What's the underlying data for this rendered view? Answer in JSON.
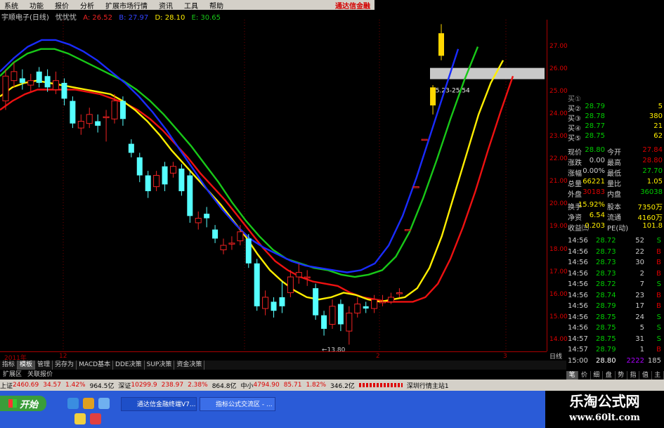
{
  "menu": {
    "items": [
      "系统",
      "功能",
      "报价",
      "分析",
      "扩展市场行情",
      "资讯",
      "工具",
      "帮助"
    ],
    "brand": "通达信金融"
  },
  "title": {
    "stock": "宇顺电子(日线)",
    "indicator": "忧忧忧",
    "a": "A: 26.52",
    "b": "B: 27.97",
    "d": "D: 28.10",
    "e": "E: 30.65"
  },
  "chart": {
    "y_ticks": [
      "27.00",
      "26.00",
      "25.00",
      "24.00",
      "23.00",
      "22.00",
      "21.00",
      "20.00",
      "19.00",
      "18.00",
      "17.00",
      "16.00",
      "15.00",
      "14.00"
    ],
    "x_labels": [
      "2011年",
      "12",
      "2",
      "3"
    ],
    "low_label": "←13.80",
    "range_label": "25.23-25.54",
    "colors": {
      "blue": "#1a2cff",
      "green": "#18c818",
      "red": "#ee1111",
      "yellow": "#ffee00",
      "up": "#ee2222",
      "down": "#55ffff"
    }
  },
  "chart_data": {
    "type": "candlestick",
    "y_range": [
      13.5,
      28.2
    ],
    "candles": [
      {
        "o": 24.6,
        "c": 25.7,
        "h": 26.0,
        "l": 24.2
      },
      {
        "o": 25.5,
        "c": 25.9,
        "h": 26.3,
        "l": 25.2
      },
      {
        "o": 25.6,
        "c": 25.4,
        "h": 26.0,
        "l": 25.1
      },
      {
        "o": 25.3,
        "c": 25.5,
        "h": 25.8,
        "l": 25.0
      },
      {
        "o": 25.9,
        "c": 25.4,
        "h": 26.1,
        "l": 25.2
      },
      {
        "o": 25.7,
        "c": 25.2,
        "h": 26.0,
        "l": 25.0
      },
      {
        "o": 25.1,
        "c": 25.5,
        "h": 25.9,
        "l": 24.9
      },
      {
        "o": 25.4,
        "c": 24.7,
        "h": 25.6,
        "l": 24.4
      },
      {
        "o": 24.6,
        "c": 23.6,
        "h": 24.8,
        "l": 23.4
      },
      {
        "o": 23.4,
        "c": 23.7,
        "h": 24.0,
        "l": 23.1
      },
      {
        "o": 23.6,
        "c": 24.0,
        "h": 24.3,
        "l": 23.4
      },
      {
        "o": 23.7,
        "c": 23.5,
        "h": 24.0,
        "l": 23.2
      },
      {
        "o": 23.9,
        "c": 23.9,
        "h": 24.2,
        "l": 22.8
      },
      {
        "o": 23.8,
        "c": 24.6,
        "h": 24.9,
        "l": 23.6
      },
      {
        "o": 24.6,
        "c": 23.8,
        "h": 24.8,
        "l": 23.5
      },
      {
        "o": 22.7,
        "c": 22.3,
        "h": 22.9,
        "l": 22.1
      },
      {
        "o": 22.1,
        "c": 21.3,
        "h": 22.3,
        "l": 21.0
      },
      {
        "o": 21.3,
        "c": 20.6,
        "h": 21.5,
        "l": 20.3
      },
      {
        "o": 20.8,
        "c": 21.3,
        "h": 21.5,
        "l": 20.6
      },
      {
        "o": 21.7,
        "c": 20.9,
        "h": 21.9,
        "l": 20.6
      },
      {
        "o": 21.4,
        "c": 21.7,
        "h": 21.9,
        "l": 21.2
      },
      {
        "o": 21.6,
        "c": 20.6,
        "h": 21.8,
        "l": 20.4
      },
      {
        "o": 21.3,
        "c": 19.5,
        "h": 21.5,
        "l": 19.2
      },
      {
        "o": 19.2,
        "c": 19.4,
        "h": 19.7,
        "l": 18.9
      },
      {
        "o": 19.6,
        "c": 19.4,
        "h": 19.9,
        "l": 19.0
      },
      {
        "o": 18.9,
        "c": 18.5,
        "h": 19.1,
        "l": 18.3
      },
      {
        "o": 18.0,
        "c": 18.2,
        "h": 18.5,
        "l": 17.8
      },
      {
        "o": 18.3,
        "c": 18.3,
        "h": 18.6,
        "l": 18.0
      },
      {
        "o": 18.4,
        "c": 18.8,
        "h": 19.1,
        "l": 18.2
      },
      {
        "o": 18.5,
        "c": 17.4,
        "h": 18.7,
        "l": 17.2
      },
      {
        "o": 17.4,
        "c": 15.5,
        "h": 17.6,
        "l": 15.3
      },
      {
        "o": 15.4,
        "c": 15.9,
        "h": 16.2,
        "l": 15.1
      },
      {
        "o": 15.7,
        "c": 15.3,
        "h": 15.9,
        "l": 15.0
      },
      {
        "o": 15.9,
        "c": 15.5,
        "h": 16.6,
        "l": 15.2
      },
      {
        "o": 16.1,
        "c": 16.8,
        "h": 17.1,
        "l": 15.9
      },
      {
        "o": 16.8,
        "c": 17.0,
        "h": 17.4,
        "l": 16.5
      },
      {
        "o": 16.8,
        "c": 16.8,
        "h": 17.1,
        "l": 16.4
      },
      {
        "o": 16.3,
        "c": 15.1,
        "h": 16.5,
        "l": 14.9
      },
      {
        "o": 15.1,
        "c": 14.5,
        "h": 15.3,
        "l": 14.2
      },
      {
        "o": 14.7,
        "c": 15.5,
        "h": 15.8,
        "l": 14.5
      },
      {
        "o": 15.6,
        "c": 14.7,
        "h": 15.8,
        "l": 14.4
      },
      {
        "o": 14.4,
        "c": 15.2,
        "h": 15.5,
        "l": 13.8
      },
      {
        "o": 15.2,
        "c": 15.6,
        "h": 15.9,
        "l": 15.0
      },
      {
        "o": 15.5,
        "c": 15.4,
        "h": 15.7,
        "l": 15.2
      },
      {
        "o": 15.4,
        "c": 15.8,
        "h": 16.0,
        "l": 15.2
      },
      {
        "o": 15.7,
        "c": 15.7,
        "h": 16.0,
        "l": 15.5
      },
      {
        "o": 15.7,
        "c": 15.9,
        "h": 16.1,
        "l": 15.6
      },
      {
        "o": 16.1,
        "c": 16.1,
        "h": 16.3,
        "l": 15.9
      },
      {
        "o": 18.9,
        "c": 18.9,
        "h": 18.9,
        "l": 18.9
      },
      {
        "o": 20.8,
        "c": 20.8,
        "h": 20.8,
        "l": 20.8
      },
      {
        "o": 22.9,
        "c": 22.9,
        "h": 22.9,
        "l": 22.9
      },
      {
        "o": 24.4,
        "c": 25.2,
        "h": 25.3,
        "l": 24.0
      },
      {
        "o": 26.6,
        "c": 27.6,
        "h": 28.0,
        "l": 26.4
      }
    ],
    "lines": {
      "yellow": [
        24.8,
        25.2,
        25.4,
        25.5,
        25.4,
        25.3,
        25.2,
        25.1,
        25.0,
        24.9,
        24.6,
        24.2,
        23.7,
        23.1,
        22.4,
        21.8,
        21.2,
        20.6,
        20.0,
        19.3,
        18.6,
        17.8,
        17.1,
        16.6,
        16.2,
        15.9,
        15.8,
        15.9,
        16.1,
        16.0,
        15.8,
        15.7,
        15.8,
        15.9,
        16.3,
        17.2,
        18.6,
        20.4,
        22.2,
        24.0,
        25.4,
        26.4
      ],
      "red": [
        24.2,
        24.6,
        24.9,
        25.1,
        25.1,
        25.1,
        25.1,
        25.0,
        24.9,
        24.7,
        24.5,
        24.2,
        23.8,
        23.3,
        22.7,
        22.1,
        21.4,
        20.8,
        20.2,
        19.5,
        18.8,
        18.1,
        17.5,
        17.1,
        16.8,
        16.6,
        16.5,
        16.4,
        16.1,
        15.9,
        15.8,
        15.7,
        15.7,
        15.7,
        15.9,
        16.5,
        17.6,
        19.0,
        20.6,
        22.4,
        24.1,
        25.7
      ],
      "green": [
        25.7,
        26.3,
        26.7,
        26.9,
        26.9,
        26.7,
        26.4,
        26.1,
        25.8,
        25.5,
        25.1,
        24.6,
        24.0,
        23.3,
        22.6,
        21.8,
        21.0,
        20.1,
        19.3,
        18.6,
        18.0,
        17.6,
        17.4,
        17.2,
        17.1,
        16.9,
        16.8,
        16.9,
        17.1,
        17.7,
        18.8,
        20.3,
        22.0,
        23.8,
        25.5,
        27.0
      ],
      "blue": [
        25.9,
        26.5,
        27.0,
        27.3,
        27.3,
        27.1,
        26.8,
        26.4,
        25.9,
        25.4,
        24.8,
        24.1,
        23.3,
        22.4,
        21.5,
        20.6,
        19.8,
        19.1,
        18.5,
        18.1,
        17.8,
        17.5,
        17.3,
        17.2,
        17.1,
        17.0,
        17.1,
        17.4,
        18.2,
        19.5,
        21.2,
        23.1,
        25.0,
        26.9
      ]
    }
  },
  "tabs": [
    "指标",
    "模板",
    "管理",
    "另存为",
    "MACD基本",
    "DDE决策",
    "SUP决策",
    "资金决策"
  ],
  "tabs2": [
    "扩展区",
    "关联报价"
  ],
  "quote": {
    "asks": [
      {
        "label": "买②",
        "price": "28.79",
        "vol": "5"
      },
      {
        "label": "买③",
        "price": "28.78",
        "vol": "380"
      },
      {
        "label": "买④",
        "price": "28.77",
        "vol": "21"
      },
      {
        "label": "买⑤",
        "price": "28.75",
        "vol": "62"
      }
    ],
    "stats": [
      {
        "k1": "现价",
        "v1": "28.80",
        "k2": "今开",
        "v2": "27.84"
      },
      {
        "k1": "涨跌",
        "v1": "0.00",
        "k2": "最高",
        "v2": "28.80"
      },
      {
        "k1": "涨幅",
        "v1": "0.00%",
        "k2": "最低",
        "v2": "27.70"
      },
      {
        "k1": "总量",
        "v1": "66221",
        "k2": "量比",
        "v2": "1.05"
      },
      {
        "k1": "外盘",
        "v1": "30183",
        "k2": "内盘",
        "v2": "36038"
      },
      {
        "k1": "换手",
        "v1": "15.92%",
        "k2": "股本",
        "v2": "7350万"
      },
      {
        "k1": "净资",
        "v1": "6.54",
        "k2": "流通",
        "v2": "4160万"
      },
      {
        "k1": "收益㈢",
        "v1": "0.203",
        "k2": "PE(动)",
        "v2": "101.8"
      }
    ],
    "ticks": [
      {
        "t": "14:56",
        "p": "28.72",
        "v": "52",
        "s": "S"
      },
      {
        "t": "14:56",
        "p": "28.73",
        "v": "22",
        "s": "B"
      },
      {
        "t": "14:56",
        "p": "28.73",
        "v": "30",
        "s": "B"
      },
      {
        "t": "14:56",
        "p": "28.73",
        "v": "2",
        "s": "B"
      },
      {
        "t": "14:56",
        "p": "28.72",
        "v": "7",
        "s": "S"
      },
      {
        "t": "14:56",
        "p": "28.74",
        "v": "23",
        "s": "B"
      },
      {
        "t": "14:56",
        "p": "28.79",
        "v": "17",
        "s": "B"
      },
      {
        "t": "14:56",
        "p": "28.75",
        "v": "24",
        "s": "S"
      },
      {
        "t": "14:56",
        "p": "28.75",
        "v": "5",
        "s": "S"
      },
      {
        "t": "14:57",
        "p": "28.75",
        "v": "31",
        "s": "S"
      },
      {
        "t": "14:57",
        "p": "28.79",
        "v": "1",
        "s": "B"
      },
      {
        "t": "15:00",
        "p": "28.80",
        "v": "2222",
        "s": "185"
      }
    ],
    "day_button": "日线",
    "panel_tabs": [
      "笔",
      "价",
      "细",
      "盘",
      "势",
      "指",
      "值",
      "主"
    ]
  },
  "status": {
    "sh_label": "上证",
    "sh_val": "2460.69",
    "sh_chg": "34.57",
    "sh_pct": "1.42%",
    "sh_amt": "964.5亿",
    "sz_label": "深证",
    "sz_val": "10299.9",
    "sz_chg": "238.97",
    "sz_pct": "2.38%",
    "sz_amt": "864.8亿",
    "zx_label": "中小",
    "zx_val": "4794.90",
    "zx_chg": "85.71",
    "zx_pct": "1.82%",
    "zx_amt": "346.2亿",
    "site": "深圳行情主站1"
  },
  "taskbar": {
    "start": "开始",
    "task1": "通达信金融终端V7...",
    "task2": "指标公式交流区 - ..."
  },
  "watermark": {
    "line1": "乐淘公式网",
    "line2": "www.60lt.com"
  }
}
